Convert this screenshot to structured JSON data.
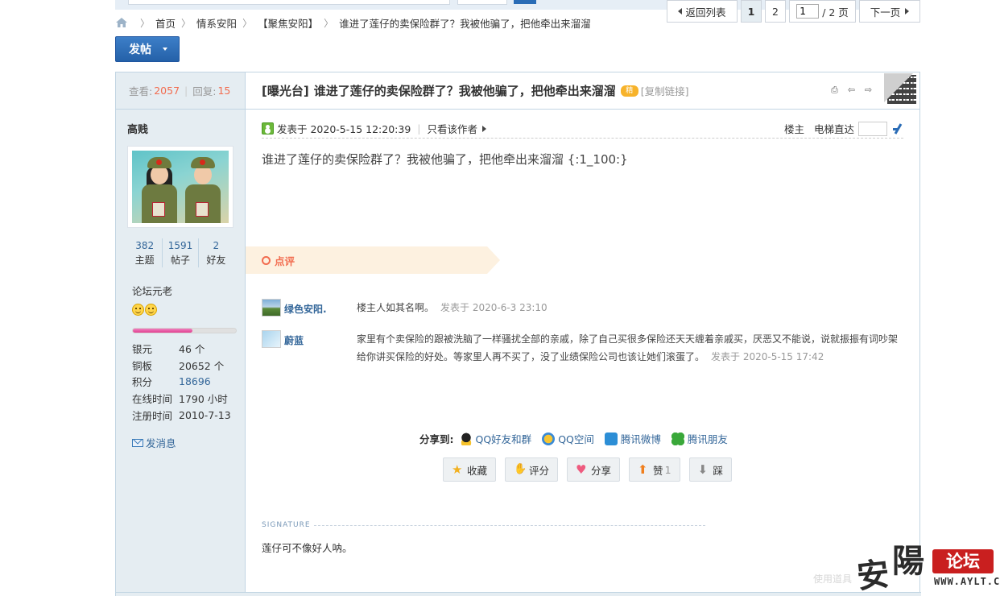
{
  "breadcrumb": {
    "items": [
      "首页",
      "情系安阳",
      "【聚焦安阳】",
      "谁进了莲仔的卖保险群了？我被他骗了，把他牵出来溜溜"
    ]
  },
  "post_button": {
    "label": "发帖"
  },
  "pager": {
    "back_label": "返回列表",
    "pages": [
      "1",
      "2"
    ],
    "current_page": "1",
    "page_input_value": "1",
    "total_label": "/ 2 页",
    "next_label": "下一页"
  },
  "thread": {
    "views_label": "查看:",
    "views": "2057",
    "replies_label": "回复:",
    "replies": "15",
    "category": "[曝光台]",
    "title": "谁进了莲仔的卖保险群了？我被他骗了，把他牵出来溜溜",
    "badge": "精",
    "copy_link": "[复制链接]"
  },
  "author": {
    "name": "高贱",
    "stats": [
      {
        "value": "382",
        "label": "主题"
      },
      {
        "value": "1591",
        "label": "帖子"
      },
      {
        "value": "2",
        "label": "好友"
      }
    ],
    "rank": "论坛元老",
    "level_progress": 0.58,
    "info": [
      {
        "key": "银元",
        "value": "46 个"
      },
      {
        "key": "铜板",
        "value": "20652 个"
      },
      {
        "key": "积分",
        "value": "18696"
      },
      {
        "key": "在线时间",
        "value": "1790 小时"
      },
      {
        "key": "注册时间",
        "value": "2010-7-13"
      }
    ],
    "send_message": "发消息"
  },
  "post": {
    "posted_at": "发表于 2020-5-15 12:20:39",
    "only_author": "只看该作者",
    "floor_label": "楼主",
    "elevator_label": "电梯直达",
    "body": "谁进了莲仔的卖保险群了？我被他骗了，把他牵出来溜溜 {:1_100:}"
  },
  "review": {
    "tab_label": "点评",
    "comments": [
      {
        "user": "绿色安阳.",
        "text": "楼主人如其名啊。",
        "time": "发表于 2020-6-3 23:10"
      },
      {
        "user": "蔚蓝",
        "text": "家里有个卖保险的跟被洗脑了一样骚扰全部的亲戚，除了自己买很多保险还天天缠着亲戚买，厌恶又不能说，说就振振有词吵架给你讲买保险的好处。等家里人再不买了，没了业绩保险公司也该让她们滚蛋了。",
        "time": "发表于 2020-5-15 17:42"
      }
    ]
  },
  "share": {
    "label": "分享到:",
    "items": [
      "QQ好友和群",
      "QQ空间",
      "腾讯微博",
      "腾讯朋友"
    ]
  },
  "actions": [
    {
      "label": "收藏",
      "count": ""
    },
    {
      "label": "评分",
      "count": ""
    },
    {
      "label": "分享",
      "count": ""
    },
    {
      "label": "赞",
      "count": "1"
    },
    {
      "label": "踩",
      "count": ""
    }
  ],
  "signature": {
    "label": "SIGNATURE",
    "text": "莲仔可不像好人呐。"
  },
  "use_tool": "使用道具",
  "watermark": {
    "char1": "安",
    "char2": "陽",
    "badge": "论坛",
    "url": "WWW.AYLT.CN"
  },
  "colors": {
    "link": "#336699",
    "accent_red": "#f26c4f",
    "brand_blue": "#2461a8"
  }
}
